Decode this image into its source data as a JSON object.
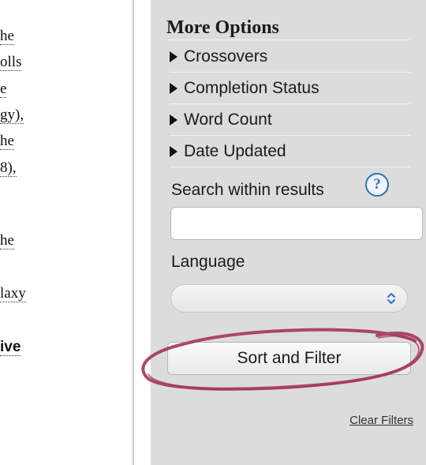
{
  "article_fragments": [
    {
      "id": "frag-1",
      "text": "he",
      "link": true
    },
    {
      "id": "frag-2",
      "text": "olls",
      "link": true
    },
    {
      "id": "frag-3",
      "text": "e",
      "link": true
    },
    {
      "id": "frag-4",
      "text": "gy),",
      "link": true
    },
    {
      "id": "frag-5",
      "text": "he",
      "link": true
    },
    {
      "id": "frag-6",
      "text": "8),",
      "link": true
    },
    {
      "id": "frag-7",
      "text": "he",
      "link": true
    },
    {
      "id": "frag-8",
      "text": "laxy",
      "link": true
    },
    {
      "id": "frag-9",
      "text": "ive",
      "link": true,
      "bold": true
    }
  ],
  "sidebar": {
    "title": "More Options",
    "options": [
      {
        "label": "Crossovers"
      },
      {
        "label": "Completion Status"
      },
      {
        "label": "Word Count"
      },
      {
        "label": "Date Updated"
      }
    ],
    "search": {
      "label": "Search within results",
      "help_glyph": "?",
      "value": ""
    },
    "language": {
      "label": "Language",
      "selected": ""
    },
    "submit_label": "Sort and Filter",
    "clear_label": "Clear Filters",
    "annotation_color": "#a3345e",
    "accent_color": "#2f6fb6"
  }
}
